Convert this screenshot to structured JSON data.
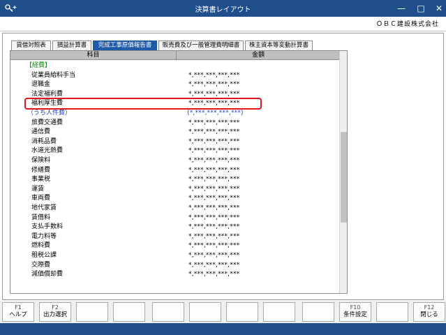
{
  "window": {
    "title": "決算書レイアウト",
    "minimize": "—",
    "maximize": "□",
    "close": "✕"
  },
  "company": "ＯＢＣ建設株式会社",
  "tabs": [
    {
      "label": "貸借対照表"
    },
    {
      "label": "損益計算書"
    },
    {
      "label": "完成工事原価報告書"
    },
    {
      "label": "販売費及び一般管理費明細書"
    },
    {
      "label": "株主資本等変動計算書"
    }
  ],
  "active_tab_index": 2,
  "table": {
    "columns": [
      "科目",
      "金額"
    ],
    "rows": [
      {
        "name": "【経費】",
        "amount": "",
        "type": "section"
      },
      {
        "name": "従業員給料手当",
        "amount": "*,***,***,***,***",
        "type": "item"
      },
      {
        "name": "退職金",
        "amount": "*,***,***,***,***",
        "type": "item"
      },
      {
        "name": "法定福利費",
        "amount": "*,***,***,***,***",
        "type": "item"
      },
      {
        "name": "福利厚生費",
        "amount": "*,***,***,***,***",
        "type": "item"
      },
      {
        "name": "（うち人件費）",
        "amount": "(*,***,***,***,***)",
        "type": "blue"
      },
      {
        "name": "旅費交通費",
        "amount": "*,***,***,***,***",
        "type": "item"
      },
      {
        "name": "通信費",
        "amount": "*,***,***,***,***",
        "type": "item"
      },
      {
        "name": "消耗品費",
        "amount": "*,***,***,***,***",
        "type": "item"
      },
      {
        "name": "水道光熱費",
        "amount": "*,***,***,***,***",
        "type": "item"
      },
      {
        "name": "保険料",
        "amount": "*,***,***,***,***",
        "type": "item"
      },
      {
        "name": "修繕費",
        "amount": "*,***,***,***,***",
        "type": "item"
      },
      {
        "name": "事業税",
        "amount": "*,***,***,***,***",
        "type": "item"
      },
      {
        "name": "運賃",
        "amount": "*,***,***,***,***",
        "type": "item"
      },
      {
        "name": "車両費",
        "amount": "*,***,***,***,***",
        "type": "item"
      },
      {
        "name": "地代家賃",
        "amount": "*,***,***,***,***",
        "type": "item"
      },
      {
        "name": "賃借料",
        "amount": "*,***,***,***,***",
        "type": "item"
      },
      {
        "name": "支払手数料",
        "amount": "*,***,***,***,***",
        "type": "item"
      },
      {
        "name": "電力料等",
        "amount": "*,***,***,***,***",
        "type": "item"
      },
      {
        "name": "燃料費",
        "amount": "*,***,***,***,***",
        "type": "item"
      },
      {
        "name": "租税公課",
        "amount": "*,***,***,***,***",
        "type": "item"
      },
      {
        "name": "交際費",
        "amount": "*,***,***,***,***",
        "type": "item"
      },
      {
        "name": "減価償却費",
        "amount": "*,***,***,***,***",
        "type": "item"
      }
    ]
  },
  "fkeys": [
    {
      "key": "F1",
      "label": "ヘルプ"
    },
    {
      "key": "F2",
      "label": "出力選択"
    },
    {
      "key": "",
      "label": ""
    },
    {
      "key": "",
      "label": ""
    },
    {
      "key": "",
      "label": ""
    },
    {
      "key": "",
      "label": ""
    },
    {
      "key": "",
      "label": ""
    },
    {
      "key": "",
      "label": ""
    },
    {
      "key": "",
      "label": ""
    },
    {
      "key": "F10",
      "label": "条件設定"
    },
    {
      "key": "",
      "label": ""
    },
    {
      "key": "F12",
      "label": "閉じる"
    }
  ],
  "colors": {
    "titlebar": "#1f4f8a",
    "active_tab": "#1f5aa8",
    "highlight": "#e0151f",
    "blue_text": "#1f3fcf",
    "section_text": "#1a8a1a"
  }
}
